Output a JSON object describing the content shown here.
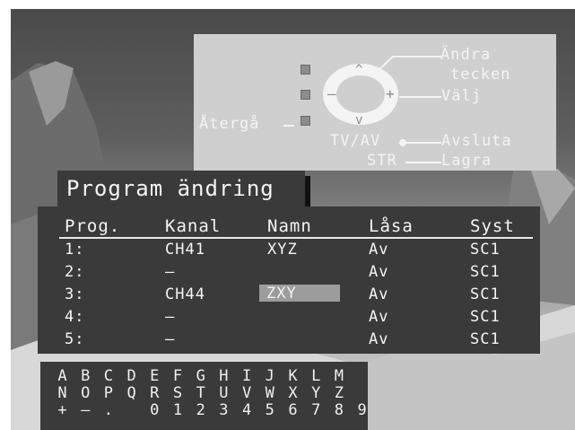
{
  "help": {
    "andra": "Ändra",
    "tecken": "tecken",
    "valj": "Välj",
    "atergå": "Återgå",
    "tvav": "TV/AV",
    "avsluta": "Avsluta",
    "str": "STR",
    "lagra": "Lagra"
  },
  "title": "Program ändring",
  "table": {
    "headers": [
      "Prog.",
      "Kanal",
      "Namn",
      "Låsa",
      "Syst"
    ],
    "rows": [
      [
        "1:",
        "CH41",
        "XYZ",
        "Av",
        "SC1"
      ],
      [
        "2:",
        "–",
        "",
        "Av",
        "SC1"
      ],
      [
        "3:",
        "CH44",
        "ZXY",
        "Av",
        "SC1"
      ],
      [
        "4:",
        "–",
        "",
        "Av",
        "SC1"
      ],
      [
        "5:",
        "–",
        "",
        "Av",
        "SC1"
      ]
    ],
    "selected_row": 2
  },
  "chars": {
    "row1": [
      "A",
      "B",
      "C",
      "D",
      "E",
      "F",
      "G",
      "H",
      "I",
      "J",
      "K",
      "L",
      "M"
    ],
    "row2": [
      "N",
      "O",
      "P",
      "Q",
      "R",
      "S",
      "T",
      "U",
      "V",
      "W",
      "X",
      "Y",
      "Z"
    ],
    "row3": [
      "+",
      "–",
      ".",
      "",
      "0",
      "1",
      "2",
      "3",
      "4",
      "5",
      "6",
      "7",
      "8",
      "9"
    ]
  },
  "colors": {
    "panel": "#3a3a3a",
    "help_panel": "#cfcfcf",
    "highlight": "#9c9c9c",
    "text": "#f4f4f4"
  }
}
